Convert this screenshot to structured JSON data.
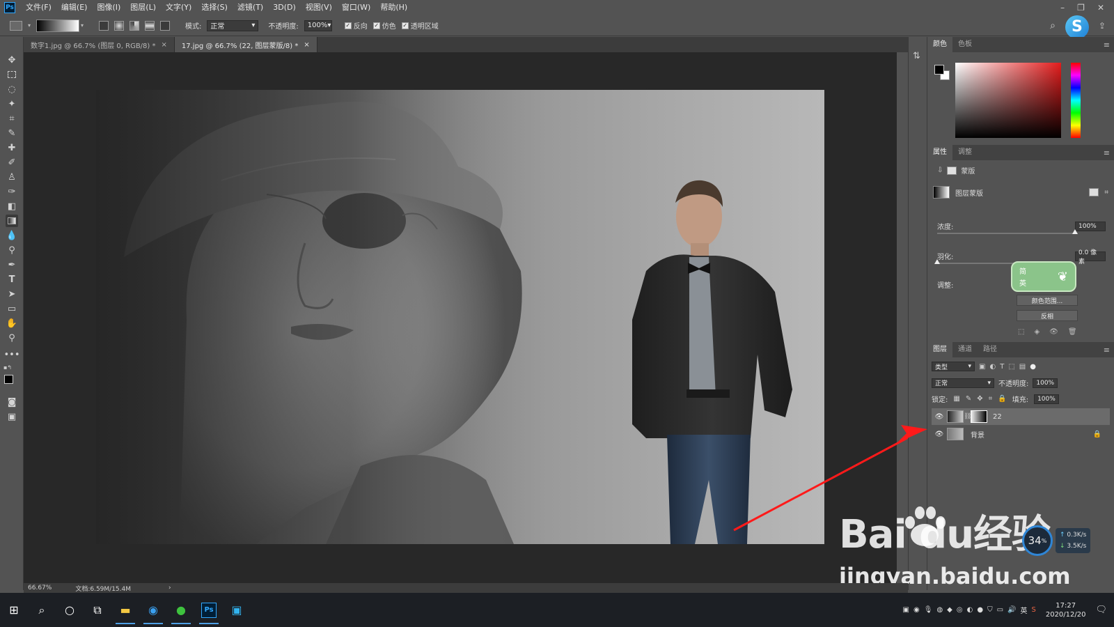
{
  "menubar": {
    "app_logo": "Ps",
    "items": [
      "文件(F)",
      "编辑(E)",
      "图像(I)",
      "图层(L)",
      "文字(Y)",
      "选择(S)",
      "滤镜(T)",
      "3D(D)",
      "视图(V)",
      "窗口(W)",
      "帮助(H)"
    ],
    "window_controls": [
      "–",
      "❐",
      "✕"
    ]
  },
  "options": {
    "mode_label": "模式:",
    "mode_value": "正常",
    "opacity_label": "不透明度:",
    "opacity_value": "100%",
    "reverse_label": "反向",
    "dither_label": "仿色",
    "transparency_label": "透明区域"
  },
  "tabs": [
    {
      "label": "数字1.jpg @ 66.7% (图层 0, RGB/8) *",
      "close": "×"
    },
    {
      "label": "17.jpg @ 66.7% (22, 图层蒙版/8) *",
      "close": "×"
    }
  ],
  "status": {
    "zoom": "66.67%",
    "doc_size": "文档:6.59M/15.4M",
    "arrow": "›"
  },
  "color_panel": {
    "tabs": [
      "颜色",
      "色板"
    ]
  },
  "properties_panel": {
    "tabs": [
      "属性",
      "调整"
    ],
    "mask_label": "蒙版",
    "layer_mask_label": "图层蒙版",
    "density_label": "浓度:",
    "density_value": "100%",
    "feather_label": "羽化:",
    "feather_value": "0.0 像素",
    "adjust_label": "调整:",
    "color_range_button": "颜色范围...",
    "invert_button": "反相"
  },
  "ime_badge": {
    "line1": "简",
    "line2": "英"
  },
  "layers_panel": {
    "tabs": [
      "图层",
      "通道",
      "路径"
    ],
    "filter_kind": "类型",
    "blend_mode": "正常",
    "opacity_label": "不透明度:",
    "opacity_value": "100%",
    "lock_label": "锁定:",
    "fill_label": "填充:",
    "fill_value": "100%",
    "layers": [
      {
        "name": "22",
        "visible": true,
        "selected": true
      },
      {
        "name": "背景",
        "visible": true,
        "locked": true
      }
    ]
  },
  "network_widget": {
    "percent": "34",
    "percent_unit": "%",
    "up": "0.3K/s",
    "down": "3.5K/s"
  },
  "taskbar": {
    "time": "17:27",
    "date": "2020/12/20",
    "ime": "英"
  },
  "watermark": {
    "brand": "Bai  du经验",
    "url": "jingyan.baidu.com"
  },
  "colors": {
    "ui_bg": "#535353",
    "canvas_bg": "#282828",
    "accent_arrow": "#ff1a1a",
    "taskbar_bg": "#1c1f24",
    "ime_green": "#8bc48a"
  }
}
